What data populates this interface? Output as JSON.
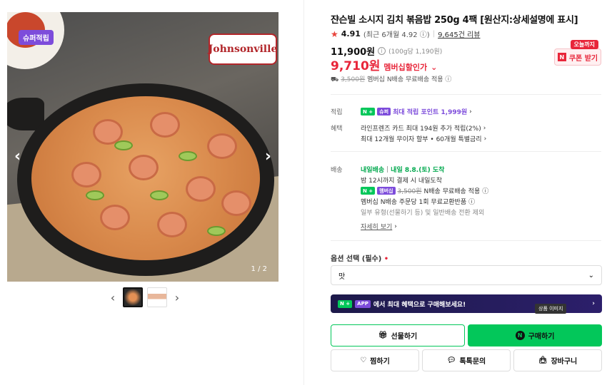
{
  "image": {
    "badge": "슈퍼적립",
    "brand_logo": "Johnsonville",
    "pager": "1 / 2",
    "prev": "‹",
    "next": "›"
  },
  "thumbs": {
    "prev": "‹",
    "next": "›"
  },
  "product": {
    "title": "쟌슨빌 소시지 김치 볶음밥 250g 4팩 [원산지:상세설명에 표시]",
    "rating": "4.91",
    "recent_rating": "(최근 6개월 4.92",
    "reviews": "9,645건 리뷰",
    "price": "11,900원",
    "unit_price": "(100g당 1,190원)",
    "member_price": "9,710원",
    "member_label": "멤버십할인가",
    "ship_orig": "3,500원",
    "ship_text": "멤버십 N배송 무료배송 적용"
  },
  "coupon": {
    "today": "오늘까지",
    "label": "쿠폰 받기",
    "n": "N"
  },
  "points": {
    "label": "적립",
    "chip1": "N +",
    "chip2": "슈퍼",
    "text": "최대 적립 포인트 1,999원"
  },
  "benefits": {
    "label": "혜택",
    "line1": "라인프렌즈 카드 최대 194원 추가 적립(2%)",
    "line2": "최대 12개월 무이자 할부 • 60개월 특별금리"
  },
  "delivery": {
    "label": "배송",
    "badge": "내일배송",
    "date": "내일 8.8.(토) 도착",
    "line1": "밤 12시까지 결제 시 내일도착",
    "chip1": "N +",
    "chip2": "멤버십",
    "orig": "3,500원",
    "free": "N배송 무료배송 적용",
    "line3": "멤버십 N배송 주문당 1회 무료교환반품",
    "line4": "일부 유형(선물하기 등) 및 일반배송 전환 제외",
    "more": "자세히 보기"
  },
  "option": {
    "label": "옵션 선택 (필수)",
    "required_mark": "•",
    "selected": "맛"
  },
  "banner": {
    "chip1": "N +",
    "chip2": "APP",
    "text": "에서 최대 혜택으로 구매해보세요!",
    "tooltip": "상품 이미지"
  },
  "buttons": {
    "gift": "선물하기",
    "buy": "구매하기",
    "buy_icon": "N",
    "wish": "찜하기",
    "talk": "톡톡문의",
    "cart": "장바구니"
  }
}
